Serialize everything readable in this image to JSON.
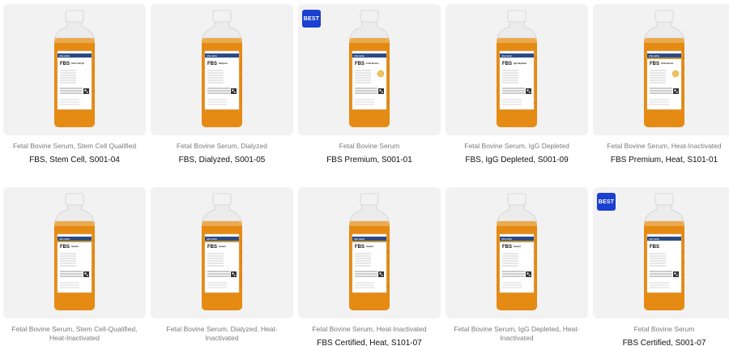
{
  "products": [
    {
      "subtitle": "Fetal Bovine Serum, Stem Cell Qualified",
      "title": "FBS, Stem Cell, S001-04",
      "badge": "",
      "label_name": "FBS",
      "label_sub": "Stem Cell Qualified",
      "seal": false,
      "heated": false
    },
    {
      "subtitle": "Fetal Bovine Serum, Dialyzed",
      "title": "FBS, Dialyzed, S001-05",
      "badge": "",
      "label_name": "FBS",
      "label_sub": "Dialyzed",
      "seal": false,
      "heated": false
    },
    {
      "subtitle": "Fetal Bovine Serum",
      "title": "FBS Premium, S001-01",
      "badge": "BEST",
      "label_name": "FBS",
      "label_sub": "Fetal Bovine Serum",
      "seal": true,
      "heated": false
    },
    {
      "subtitle": "Fetal Bovine Serum, IgG Depleted",
      "title": "FBS, IgG Depleted, S001-09",
      "badge": "",
      "label_name": "FBS",
      "label_sub": "IgG Depleted",
      "seal": false,
      "heated": false
    },
    {
      "subtitle": "Fetal Bovine Serum, Heat-Inactivated",
      "title": "FBS Premium, Heat, S101-01",
      "badge": "",
      "label_name": "FBS",
      "label_sub": "Fetal Bovine Serum",
      "seal": true,
      "heated": true
    },
    {
      "subtitle": "Fetal Bovine Serum, Stem Cell-Qualified, Heat-Inactivated",
      "title": "",
      "badge": "",
      "label_name": "FBS",
      "label_sub": "Heated",
      "seal": false,
      "heated": true
    },
    {
      "subtitle": "Fetal Bovine Serum, Dialyzed, Heat-Inactivated",
      "title": "",
      "badge": "",
      "label_name": "FBS",
      "label_sub": "Heated",
      "seal": false,
      "heated": true
    },
    {
      "subtitle": "Fetal Bovine Serum, Heat-Inactivated",
      "title": "FBS Certified, Heat, S101-07",
      "badge": "",
      "label_name": "FBS",
      "label_sub": "Heated",
      "seal": false,
      "heated": true
    },
    {
      "subtitle": "Fetal Bovine Serum, IgG Depleted, Heat-Inactivated",
      "title": "",
      "badge": "",
      "label_name": "FBS",
      "label_sub": "Heated",
      "seal": false,
      "heated": true
    },
    {
      "subtitle": "Fetal Bovine Serum",
      "title": "FBS Certified, S001-07",
      "badge": "BEST",
      "label_name": "FBS",
      "label_sub": "",
      "seal": false,
      "heated": false
    }
  ],
  "colors": {
    "liquid": "#e58a12",
    "label_band": "#2a4a86",
    "badge": "#1a3fd1",
    "seal": "#f0c35a"
  }
}
